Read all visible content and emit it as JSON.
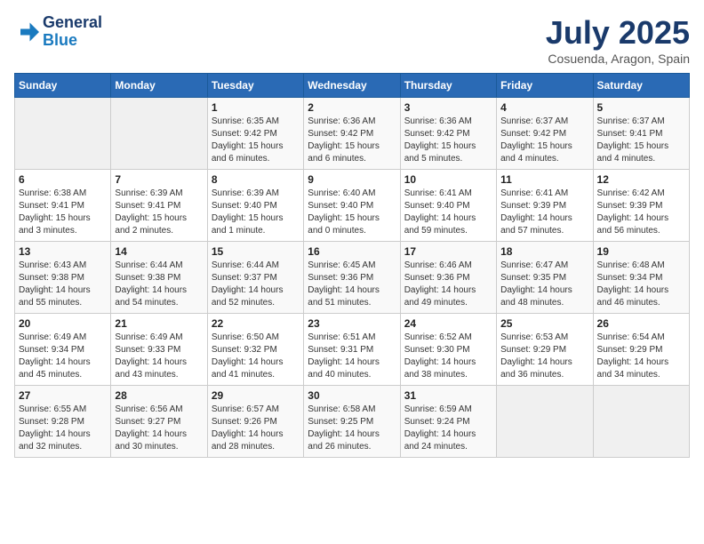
{
  "header": {
    "logo_line1": "General",
    "logo_line2": "Blue",
    "month": "July 2025",
    "location": "Cosuenda, Aragon, Spain"
  },
  "weekdays": [
    "Sunday",
    "Monday",
    "Tuesday",
    "Wednesday",
    "Thursday",
    "Friday",
    "Saturday"
  ],
  "weeks": [
    [
      {
        "day": "",
        "info": ""
      },
      {
        "day": "",
        "info": ""
      },
      {
        "day": "1",
        "info": "Sunrise: 6:35 AM\nSunset: 9:42 PM\nDaylight: 15 hours\nand 6 minutes."
      },
      {
        "day": "2",
        "info": "Sunrise: 6:36 AM\nSunset: 9:42 PM\nDaylight: 15 hours\nand 6 minutes."
      },
      {
        "day": "3",
        "info": "Sunrise: 6:36 AM\nSunset: 9:42 PM\nDaylight: 15 hours\nand 5 minutes."
      },
      {
        "day": "4",
        "info": "Sunrise: 6:37 AM\nSunset: 9:42 PM\nDaylight: 15 hours\nand 4 minutes."
      },
      {
        "day": "5",
        "info": "Sunrise: 6:37 AM\nSunset: 9:41 PM\nDaylight: 15 hours\nand 4 minutes."
      }
    ],
    [
      {
        "day": "6",
        "info": "Sunrise: 6:38 AM\nSunset: 9:41 PM\nDaylight: 15 hours\nand 3 minutes."
      },
      {
        "day": "7",
        "info": "Sunrise: 6:39 AM\nSunset: 9:41 PM\nDaylight: 15 hours\nand 2 minutes."
      },
      {
        "day": "8",
        "info": "Sunrise: 6:39 AM\nSunset: 9:40 PM\nDaylight: 15 hours\nand 1 minute."
      },
      {
        "day": "9",
        "info": "Sunrise: 6:40 AM\nSunset: 9:40 PM\nDaylight: 15 hours\nand 0 minutes."
      },
      {
        "day": "10",
        "info": "Sunrise: 6:41 AM\nSunset: 9:40 PM\nDaylight: 14 hours\nand 59 minutes."
      },
      {
        "day": "11",
        "info": "Sunrise: 6:41 AM\nSunset: 9:39 PM\nDaylight: 14 hours\nand 57 minutes."
      },
      {
        "day": "12",
        "info": "Sunrise: 6:42 AM\nSunset: 9:39 PM\nDaylight: 14 hours\nand 56 minutes."
      }
    ],
    [
      {
        "day": "13",
        "info": "Sunrise: 6:43 AM\nSunset: 9:38 PM\nDaylight: 14 hours\nand 55 minutes."
      },
      {
        "day": "14",
        "info": "Sunrise: 6:44 AM\nSunset: 9:38 PM\nDaylight: 14 hours\nand 54 minutes."
      },
      {
        "day": "15",
        "info": "Sunrise: 6:44 AM\nSunset: 9:37 PM\nDaylight: 14 hours\nand 52 minutes."
      },
      {
        "day": "16",
        "info": "Sunrise: 6:45 AM\nSunset: 9:36 PM\nDaylight: 14 hours\nand 51 minutes."
      },
      {
        "day": "17",
        "info": "Sunrise: 6:46 AM\nSunset: 9:36 PM\nDaylight: 14 hours\nand 49 minutes."
      },
      {
        "day": "18",
        "info": "Sunrise: 6:47 AM\nSunset: 9:35 PM\nDaylight: 14 hours\nand 48 minutes."
      },
      {
        "day": "19",
        "info": "Sunrise: 6:48 AM\nSunset: 9:34 PM\nDaylight: 14 hours\nand 46 minutes."
      }
    ],
    [
      {
        "day": "20",
        "info": "Sunrise: 6:49 AM\nSunset: 9:34 PM\nDaylight: 14 hours\nand 45 minutes."
      },
      {
        "day": "21",
        "info": "Sunrise: 6:49 AM\nSunset: 9:33 PM\nDaylight: 14 hours\nand 43 minutes."
      },
      {
        "day": "22",
        "info": "Sunrise: 6:50 AM\nSunset: 9:32 PM\nDaylight: 14 hours\nand 41 minutes."
      },
      {
        "day": "23",
        "info": "Sunrise: 6:51 AM\nSunset: 9:31 PM\nDaylight: 14 hours\nand 40 minutes."
      },
      {
        "day": "24",
        "info": "Sunrise: 6:52 AM\nSunset: 9:30 PM\nDaylight: 14 hours\nand 38 minutes."
      },
      {
        "day": "25",
        "info": "Sunrise: 6:53 AM\nSunset: 9:29 PM\nDaylight: 14 hours\nand 36 minutes."
      },
      {
        "day": "26",
        "info": "Sunrise: 6:54 AM\nSunset: 9:29 PM\nDaylight: 14 hours\nand 34 minutes."
      }
    ],
    [
      {
        "day": "27",
        "info": "Sunrise: 6:55 AM\nSunset: 9:28 PM\nDaylight: 14 hours\nand 32 minutes."
      },
      {
        "day": "28",
        "info": "Sunrise: 6:56 AM\nSunset: 9:27 PM\nDaylight: 14 hours\nand 30 minutes."
      },
      {
        "day": "29",
        "info": "Sunrise: 6:57 AM\nSunset: 9:26 PM\nDaylight: 14 hours\nand 28 minutes."
      },
      {
        "day": "30",
        "info": "Sunrise: 6:58 AM\nSunset: 9:25 PM\nDaylight: 14 hours\nand 26 minutes."
      },
      {
        "day": "31",
        "info": "Sunrise: 6:59 AM\nSunset: 9:24 PM\nDaylight: 14 hours\nand 24 minutes."
      },
      {
        "day": "",
        "info": ""
      },
      {
        "day": "",
        "info": ""
      }
    ]
  ]
}
